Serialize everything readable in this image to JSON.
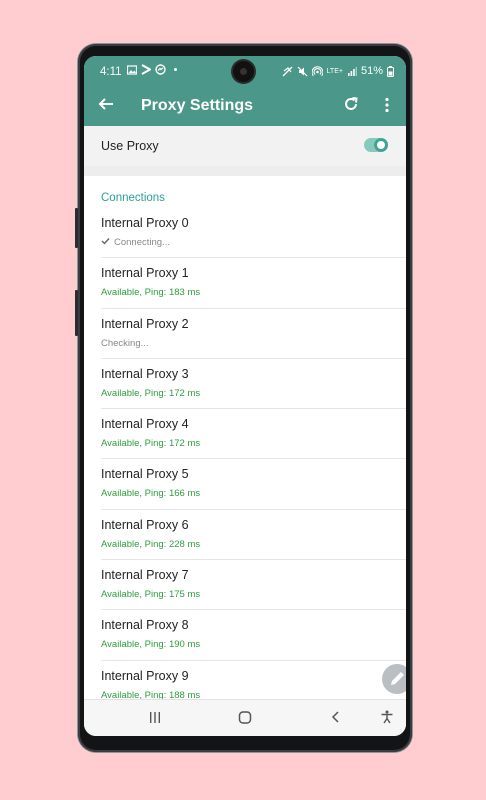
{
  "status_bar": {
    "time": "4:11",
    "left_icons": [
      "image-icon",
      "play-icon",
      "messenger-icon",
      "dot-icon"
    ],
    "right_icons": [
      "data-saver-icon",
      "mute-icon",
      "hotspot-icon",
      "lte-icon",
      "signal-icon"
    ],
    "lte_label": "LTE+",
    "battery": "51%"
  },
  "app_bar": {
    "title": "Proxy Settings",
    "back_icon": "arrow-left-icon",
    "refresh_icon": "refresh-icon",
    "more_icon": "more-vert-icon",
    "color": "#4b9789"
  },
  "use_proxy": {
    "label": "Use Proxy",
    "enabled": true
  },
  "connections": {
    "title": "Connections",
    "items": [
      {
        "name": "Internal Proxy 0",
        "status": "Connecting...",
        "state": "connecting",
        "checked": true
      },
      {
        "name": "Internal Proxy 1",
        "status": "Available, Ping: 183 ms",
        "state": "available"
      },
      {
        "name": "Internal Proxy 2",
        "status": "Checking...",
        "state": "checking"
      },
      {
        "name": "Internal Proxy 3",
        "status": "Available, Ping: 172 ms",
        "state": "available"
      },
      {
        "name": "Internal Proxy 4",
        "status": "Available, Ping: 172 ms",
        "state": "available"
      },
      {
        "name": "Internal Proxy 5",
        "status": "Available, Ping: 166 ms",
        "state": "available"
      },
      {
        "name": "Internal Proxy 6",
        "status": "Available, Ping: 228 ms",
        "state": "available"
      },
      {
        "name": "Internal Proxy 7",
        "status": "Available, Ping: 175 ms",
        "state": "available"
      },
      {
        "name": "Internal Proxy 8",
        "status": "Available, Ping: 190 ms",
        "state": "available"
      },
      {
        "name": "Internal Proxy 9",
        "status": "Available, Ping: 188 ms",
        "state": "available"
      }
    ]
  },
  "fab_icon": "pencil-icon",
  "nav_bar": {
    "icons": [
      "recents-icon",
      "home-icon",
      "back-icon",
      "accessibility-icon"
    ]
  },
  "colors": {
    "accent": "#2aa198",
    "available": "#2e9e3d",
    "background": "#ffcdd0"
  }
}
